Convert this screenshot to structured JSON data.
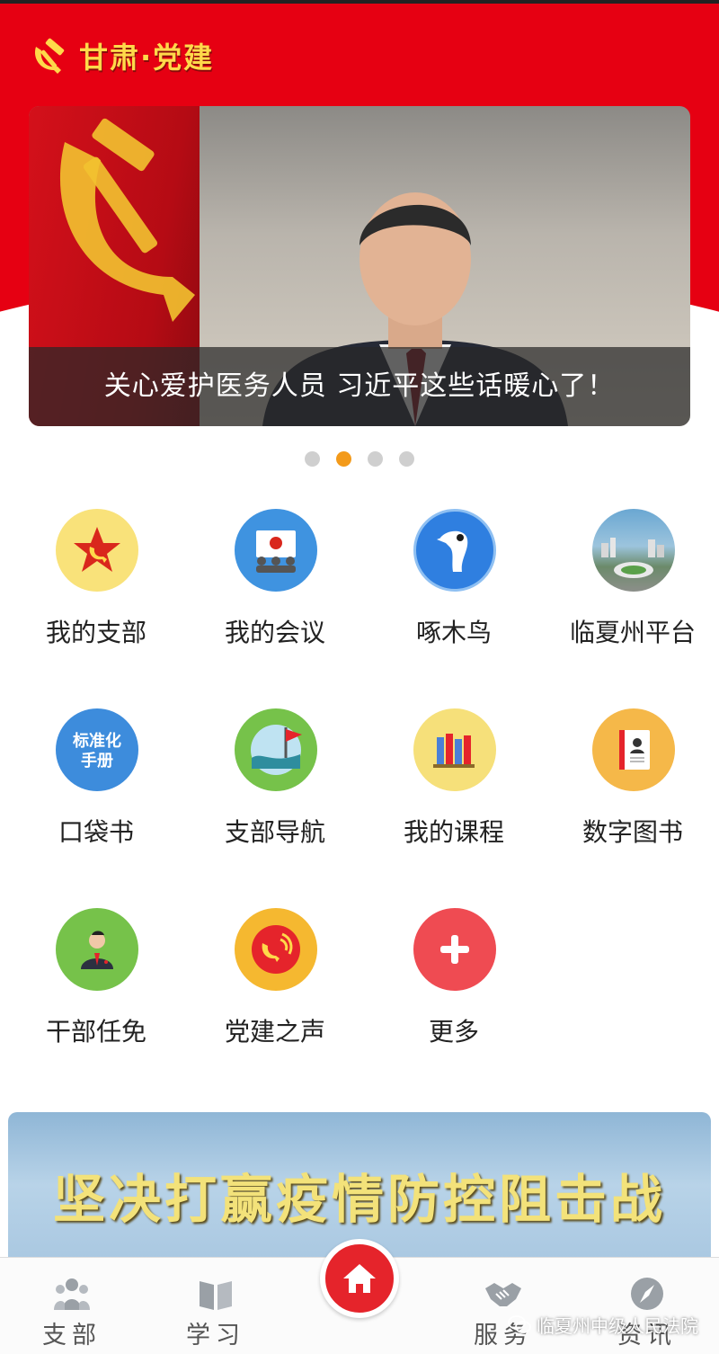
{
  "header": {
    "brand": "甘肃·党建"
  },
  "banner": {
    "caption": "关心爱护医务人员 习近平这些话暖心了！",
    "slide_count": 4,
    "active_slide": 2
  },
  "grid": {
    "items": [
      {
        "label": "我的支部",
        "icon": "party-star-icon",
        "color": "#f9e27a"
      },
      {
        "label": "我的会议",
        "icon": "meeting-icon",
        "color": "#3f93e0"
      },
      {
        "label": "啄木鸟",
        "icon": "woodpecker-icon",
        "color": "#2f7fe0"
      },
      {
        "label": "临夏州平台",
        "icon": "city-photo-icon",
        "color": "#5a8fb8"
      },
      {
        "label": "口袋书",
        "icon": "handbook-icon",
        "color": "#3d8cdc",
        "icon_text": "标准化\n手册"
      },
      {
        "label": "支部导航",
        "icon": "flag-navigation-icon",
        "color": "#76c24a"
      },
      {
        "label": "我的课程",
        "icon": "books-icon",
        "color": "#f6e07a"
      },
      {
        "label": "数字图书",
        "icon": "book-icon",
        "color": "#f5b849"
      },
      {
        "label": "干部任免",
        "icon": "official-icon",
        "color": "#76c24a"
      },
      {
        "label": "党建之声",
        "icon": "party-voice-icon",
        "color": "#f5b830"
      },
      {
        "label": "更多",
        "icon": "plus-icon",
        "color": "#ef4b52"
      }
    ]
  },
  "promo": {
    "title": "坚决打赢疫情防控阻击战"
  },
  "tabbar": {
    "tabs": [
      {
        "label": "支部",
        "icon": "people-icon"
      },
      {
        "label": "学习",
        "icon": "book-open-icon"
      },
      {
        "label": "",
        "icon": "home-icon"
      },
      {
        "label": "服务",
        "icon": "handshake-icon"
      },
      {
        "label": "资讯",
        "icon": "compass-icon"
      }
    ]
  },
  "watermark": {
    "text": "临夏州中级人民法院"
  }
}
